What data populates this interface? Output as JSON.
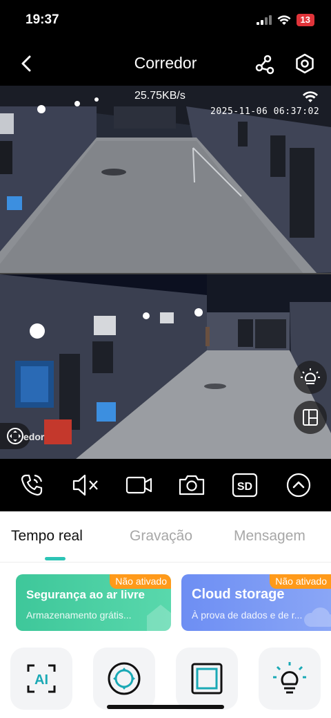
{
  "status_bar": {
    "time": "19:37",
    "battery": "13",
    "icons": [
      "signal-icon",
      "wifi-icon",
      "battery-icon"
    ]
  },
  "nav": {
    "title": "Corredor",
    "icons": [
      "back-icon",
      "share-icon",
      "settings-icon"
    ]
  },
  "video": {
    "bitrate": "25.75KB/s",
    "timestamp": "2025-11-06 06:37:02",
    "ptz_label": "edor",
    "overlay_buttons": [
      "light-icon",
      "layout-icon"
    ]
  },
  "controls": {
    "icons": [
      "call-icon",
      "mute-icon",
      "record-icon",
      "snapshot-icon",
      "sd-card-icon",
      "expand-icon"
    ],
    "sd_label": "SD"
  },
  "tabs": [
    {
      "label": "Tempo real",
      "active": true
    },
    {
      "label": "Gravação",
      "active": false
    },
    {
      "label": "Mensagem",
      "active": false
    }
  ],
  "cards": [
    {
      "title": "Segurança ao ar livre",
      "subtitle": "Armazenamento grátis...",
      "badge": "Não ativado",
      "color": "#3ec79a"
    },
    {
      "title": "Cloud storage",
      "subtitle": "À prova de dados e de r...",
      "badge": "Não ativado",
      "color": "#6d8ef3"
    }
  ],
  "feature_tiles": [
    {
      "icon": "ai-icon",
      "label": "AI"
    },
    {
      "icon": "ptz-icon"
    },
    {
      "icon": "frame-icon"
    },
    {
      "icon": "lamp-icon"
    }
  ],
  "colors": {
    "accent": "#2cc4b5",
    "badge": "#ff9a1a",
    "battery": "#e0343a"
  }
}
